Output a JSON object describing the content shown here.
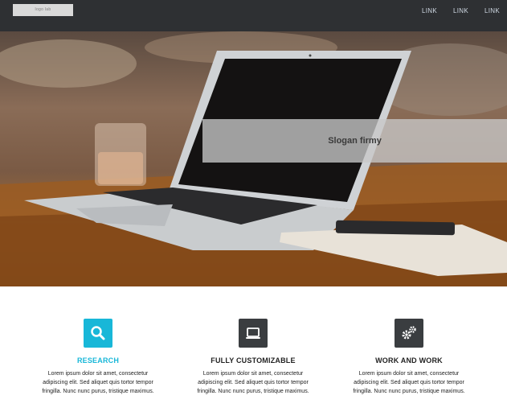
{
  "header": {
    "logo_text": "logo lab",
    "nav": [
      "LINK",
      "LINK",
      "LINK"
    ]
  },
  "hero": {
    "slogan": "Slogan firmy"
  },
  "features": [
    {
      "icon": "search-icon",
      "title": "RESEARCH",
      "color": "#18b7d8",
      "text": "Lorem ipsum dolor sit amet, consectetur adipiscing elit. Sed aliquet quis tortor tempor fringilla. Nunc nunc purus, tristique maximus."
    },
    {
      "icon": "monitor-icon",
      "title": "FULLY CUSTOMIZABLE",
      "color": "#3a3d40",
      "text": "Lorem ipsum dolor sit amet, consectetur adipiscing elit. Sed aliquet quis tortor tempor fringilla. Nunc nunc purus, tristique maximus."
    },
    {
      "icon": "gears-icon",
      "title": "WORK AND WORK",
      "color": "#3a3d40",
      "text": "Lorem ipsum dolor sit amet, consectetur adipiscing elit. Sed aliquet quis tortor tempor fringilla. Nunc nunc purus, tristique maximus."
    }
  ]
}
